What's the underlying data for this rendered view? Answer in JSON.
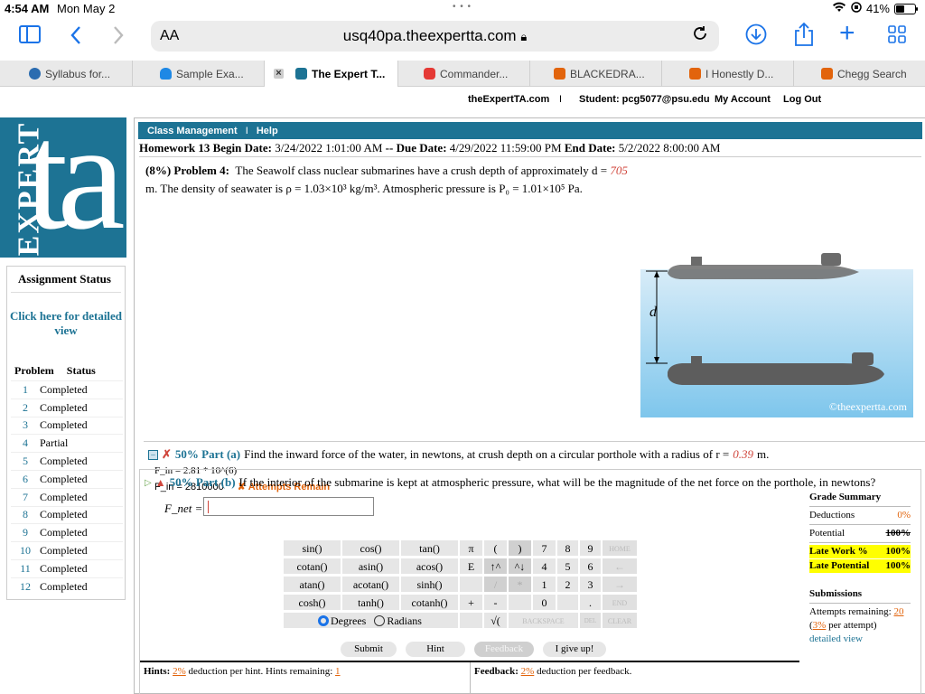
{
  "statusbar": {
    "time": "4:54 AM",
    "date": "Mon May 2",
    "battery": "41%"
  },
  "browser": {
    "aa": "AA",
    "url": "usq40pa.theexpertta.com",
    "tabs": [
      {
        "label": "Syllabus for...",
        "color": "#2b6cb0"
      },
      {
        "label": "Sample Exa...",
        "color": "#1e88e5"
      },
      {
        "label": "The Expert T...",
        "color": "#1d7394"
      },
      {
        "label": "Commander...",
        "color": "#e53935"
      },
      {
        "label": "BLACKEDRA...",
        "color": "#e2640c"
      },
      {
        "label": "I Honestly D...",
        "color": "#e2640c"
      },
      {
        "label": "Chegg Search",
        "color": "#e2640c"
      }
    ]
  },
  "site": {
    "home": "theExpertTA.com",
    "sep": "I",
    "student": "Student: pcg5077@psu.edu",
    "account": "My Account",
    "logout": "Log Out"
  },
  "logo": {
    "big": "ta",
    "vert": "EXPERT"
  },
  "status_panel": {
    "title": "Assignment Status",
    "detail": "Click here for detailed view",
    "col_problem": "Problem",
    "col_status": "Status",
    "rows": [
      {
        "n": "1",
        "s": "Completed"
      },
      {
        "n": "2",
        "s": "Completed"
      },
      {
        "n": "3",
        "s": "Completed"
      },
      {
        "n": "4",
        "s": "Partial"
      },
      {
        "n": "5",
        "s": "Completed"
      },
      {
        "n": "6",
        "s": "Completed"
      },
      {
        "n": "7",
        "s": "Completed"
      },
      {
        "n": "8",
        "s": "Completed"
      },
      {
        "n": "9",
        "s": "Completed"
      },
      {
        "n": "10",
        "s": "Completed"
      },
      {
        "n": "11",
        "s": "Completed"
      },
      {
        "n": "12",
        "s": "Completed"
      }
    ]
  },
  "nav": {
    "class_mgmt": "Class Management",
    "sep": "I",
    "help": "Help"
  },
  "homework": {
    "title": "Homework 13",
    "begin_label": "Begin Date:",
    "begin": "3/24/2022 1:01:00 AM",
    "dash": "--",
    "due_label": "Due Date:",
    "due": "4/29/2022 11:59:00 PM",
    "end_label": "End Date:",
    "end": "5/2/2022 8:00:00 AM"
  },
  "problem": {
    "weight": "(8%)",
    "label": "Problem 4:",
    "text1": "The Seawolf class nuclear submarines have a crush depth of approximately d =",
    "depth": "705",
    "text2": "m. The density of seawater is ρ = 1.03×10³ kg/m³. Atmospheric pressure is P₀ = 1.01×10⁵ Pa.",
    "diagram_label": "d",
    "watermark": "©theexpertta.com"
  },
  "part_a": {
    "pct": "50% Part (a)",
    "question": "Find the inward force of the water, in newtons, at crush depth on a circular porthole with a radius of r =",
    "radius": "0.39",
    "unit": "m.",
    "answer1": "F_in = 2.81 * 10^(6)",
    "answer2": "F_in = 2810000",
    "attempts": "✘ Attempts Remain"
  },
  "part_b": {
    "pct": "50% Part (b)",
    "question": "If the interior of the submarine is kept at atmospheric pressure, what will be the magnitude of the net force on the porthole, in newtons?",
    "fnet_label": "F_net =",
    "input_value": ""
  },
  "keypad": {
    "fn_rows": [
      [
        "sin()",
        "cos()",
        "tan()"
      ],
      [
        "cotan()",
        "asin()",
        "acos()"
      ],
      [
        "atan()",
        "acotan()",
        "sinh()"
      ],
      [
        "cosh()",
        "tanh()",
        "cotanh()"
      ]
    ],
    "const_col": [
      "π",
      "E",
      "",
      "+"
    ],
    "degrees": "Degrees",
    "radians": "Radians",
    "sqrt": "√(",
    "backspace": "BACKSPACE",
    "del": "DEL",
    "clear": "CLEAR",
    "home": "HOME",
    "end": "END"
  },
  "buttons": {
    "submit": "Submit",
    "hint": "Hint",
    "feedback": "Feedback",
    "giveup": "I give up!"
  },
  "grade": {
    "title": "Grade Summary",
    "deductions_label": "Deductions",
    "deductions": "0%",
    "potential_label": "Potential",
    "potential": "100%",
    "latework_label": "Late Work %",
    "latework": "100%",
    "latepot_label": "Late Potential",
    "latepot": "100%",
    "submissions": "Submissions",
    "attempts_label": "Attempts remaining:",
    "attempts": "20",
    "per_attempt_pre": "(",
    "per_attempt_pct": "3%",
    "per_attempt_post": " per attempt)",
    "detailed": "detailed view"
  },
  "footer": {
    "hints_label": "Hints:",
    "hints_pct": "2%",
    "hints_text": "deduction per hint. Hints remaining:",
    "hints_remaining": "1",
    "feedback_label": "Feedback:",
    "feedback_pct": "2%",
    "feedback_text": "deduction per feedback."
  },
  "colors": {
    "brand": "#1d7394",
    "accent_red": "#d0463c",
    "accent_orange": "#e2640c",
    "highlight": "#ffff00",
    "ios_blue": "#1a73e8"
  }
}
